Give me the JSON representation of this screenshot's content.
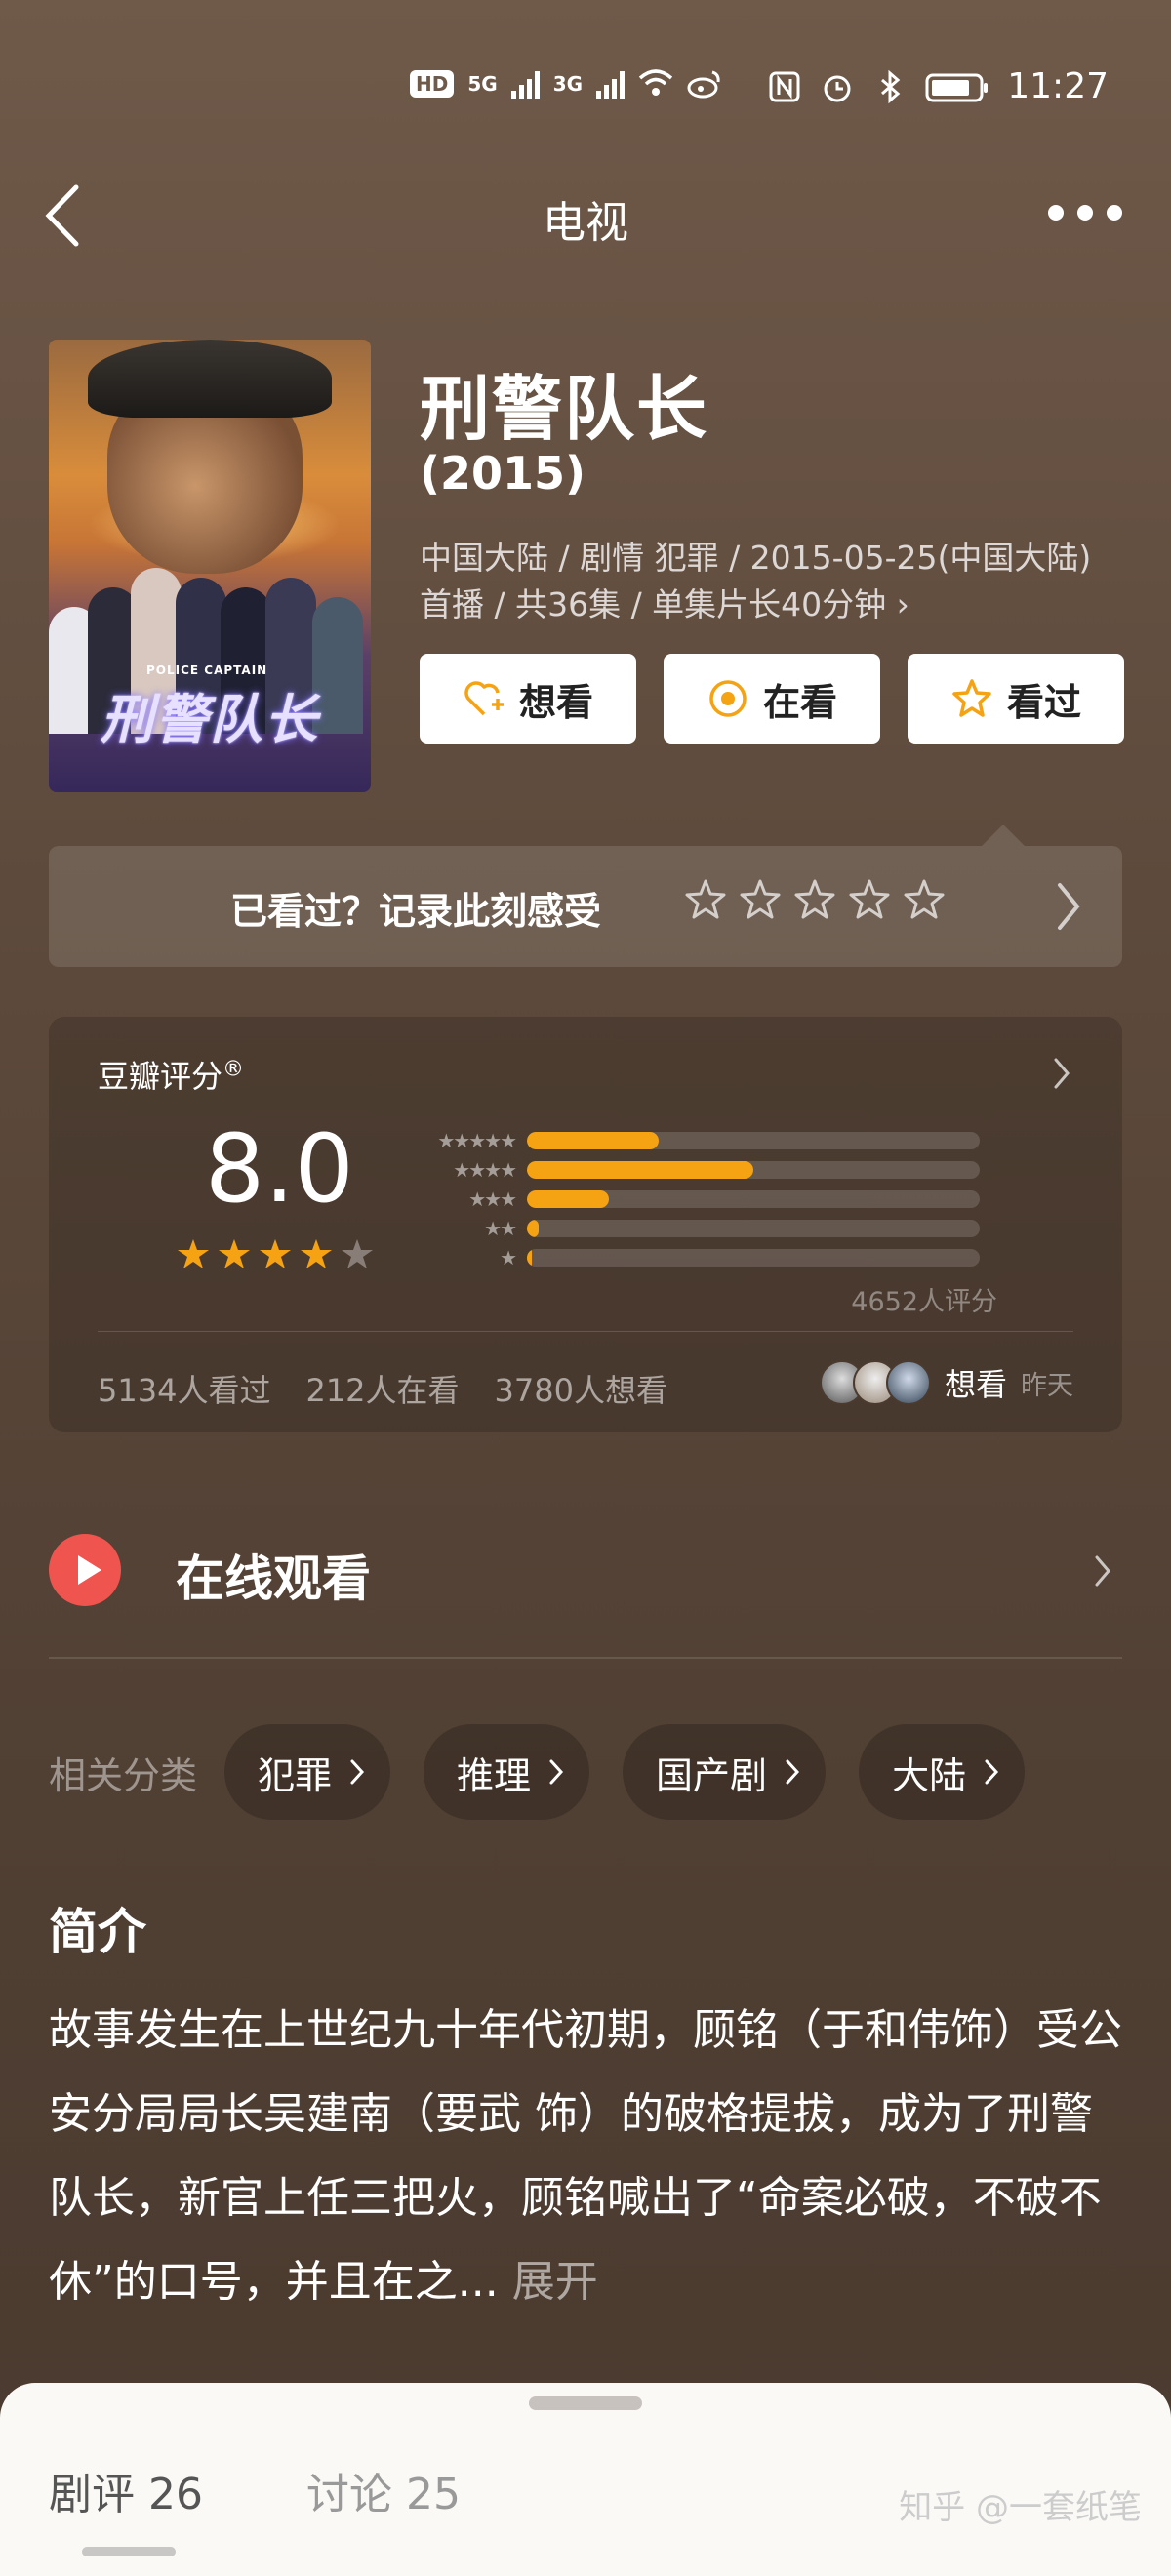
{
  "status_bar": {
    "hd": "HD",
    "net1": "5G",
    "net2": "3G",
    "time": "11:27"
  },
  "nav": {
    "title": "电视"
  },
  "show": {
    "title": "刑警队长",
    "year": "(2015)",
    "meta_line1": "中国大陆 / 剧情 犯罪 / 2015-05-25(中国大陆)",
    "meta_line2": "首播 / 共36集 / 单集片长40分钟 ›",
    "poster_logo": "刑警队长",
    "poster_sub": "POLICE CAPTAIN"
  },
  "actions": {
    "want": "想看",
    "watching": "在看",
    "watched": "看过"
  },
  "rate_prompt": {
    "text": "已看过？记录此刻感受"
  },
  "douban": {
    "label": "豆瓣评分",
    "reg": "®",
    "score": "8.0",
    "star_rating": 4,
    "distribution": [
      0.29,
      0.5,
      0.18,
      0.025,
      0.01
    ],
    "star_labels": [
      "★★★★★",
      "★★★★",
      "★★★",
      "★★",
      "★"
    ],
    "rating_count": "4652人评分",
    "watched": "5134人看过",
    "watching": "212人在看",
    "want": "3780人想看",
    "friend_action": "想看",
    "friend_time": "昨天"
  },
  "online": {
    "label": "在线观看"
  },
  "tags": {
    "label": "相关分类",
    "items": [
      "犯罪",
      "推理",
      "国产剧",
      "大陆"
    ]
  },
  "intro": {
    "title": "简介",
    "body": "故事发生在上世纪九十年代初期，顾铭（于和伟饰）受公安分局局长吴建南（要武 饰）的破格提拔，成为了刑警队长，新官上任三把火，顾铭喊出了“命案必破，不破不休”的口号，并且在之...",
    "more": " 展开"
  },
  "sheet": {
    "tab_reviews": "剧评 26",
    "tab_discussions": "讨论 25",
    "watermark": "知乎 @一套纸笔"
  },
  "colors": {
    "accent": "#f5a312",
    "play": "#f0544f",
    "background": "#5d4a3c"
  }
}
